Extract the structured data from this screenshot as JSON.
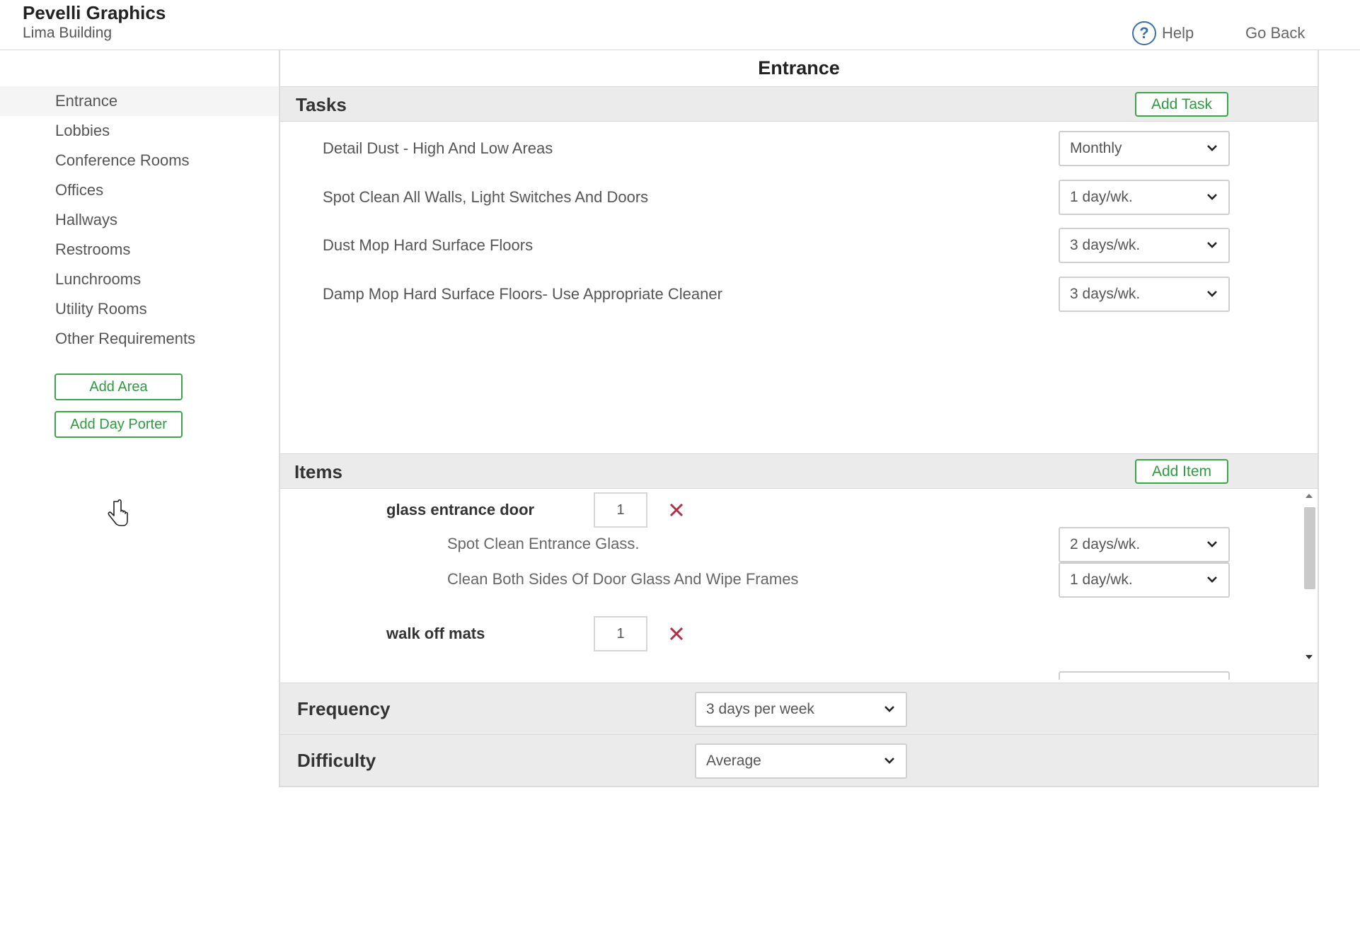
{
  "header": {
    "company": "Pevelli Graphics",
    "building": "Lima Building",
    "help_label": "Help",
    "go_back_label": "Go Back"
  },
  "sidebar": {
    "items": [
      {
        "label": "Entrance",
        "active": true
      },
      {
        "label": "Lobbies"
      },
      {
        "label": "Conference Rooms"
      },
      {
        "label": "Offices"
      },
      {
        "label": "Hallways"
      },
      {
        "label": "Restrooms"
      },
      {
        "label": "Lunchrooms"
      },
      {
        "label": "Utility Rooms"
      },
      {
        "label": "Other Requirements"
      }
    ],
    "add_area_label": "Add Area",
    "add_day_porter_label": "Add Day Porter"
  },
  "main": {
    "title": "Entrance",
    "tasks": {
      "title": "Tasks",
      "add_label": "Add Task",
      "rows": [
        {
          "label": "Detail Dust - High And Low Areas",
          "frequency": "Monthly"
        },
        {
          "label": "Spot Clean All Walls, Light Switches And Doors",
          "frequency": "1 day/wk."
        },
        {
          "label": "Dust Mop Hard Surface Floors",
          "frequency": "3 days/wk."
        },
        {
          "label": "Damp Mop Hard Surface Floors- Use Appropriate Cleaner",
          "frequency": "3 days/wk."
        }
      ]
    },
    "items": {
      "title": "Items",
      "add_label": "Add Item",
      "list": [
        {
          "name": "glass entrance door",
          "quantity": "1",
          "tasks": [
            {
              "label": "Spot Clean Entrance Glass.",
              "frequency": "2 days/wk."
            },
            {
              "label": "Clean Both Sides Of Door Glass And Wipe Frames",
              "frequency": "1 day/wk."
            }
          ]
        },
        {
          "name": "walk off mats",
          "quantity": "1",
          "tasks": []
        }
      ]
    },
    "frequency": {
      "label": "Frequency",
      "value": "3 days per week"
    },
    "difficulty": {
      "label": "Difficulty",
      "value": "Average"
    }
  },
  "colors": {
    "accent_green": "#3aa64a",
    "remove_red": "#b03045",
    "help_blue": "#3a6fa8"
  }
}
